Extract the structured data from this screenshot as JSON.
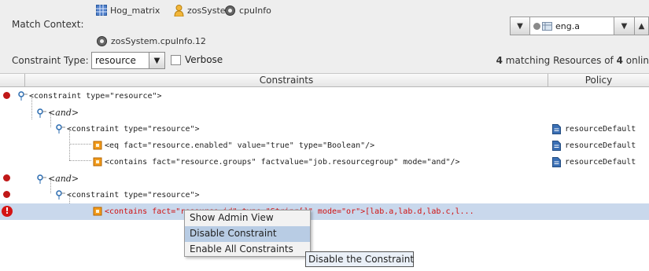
{
  "header": {
    "match_context_label": "Match Context:",
    "context_items": [
      {
        "label": "Hog_matrix",
        "icon": "grid-icon"
      },
      {
        "label": "zosSystem",
        "icon": "user-icon"
      },
      {
        "label": "cpuInfo",
        "icon": "gear-icon"
      },
      {
        "label": "zosSystem.cpuInfo.12",
        "icon": "gear-icon"
      }
    ],
    "environment_value": "eng.a"
  },
  "filter": {
    "constraint_type_label": "Constraint Type:",
    "constraint_type_value": "resource",
    "verbose_label": "Verbose",
    "match_count": "4",
    "match_text": " matching Resources of ",
    "match_total": "4",
    "match_suffix": " onlin"
  },
  "table": {
    "columns": [
      "Constraints",
      "Policy"
    ],
    "rows": [
      {
        "text": "<constraint type=\"resource\">",
        "marker": "dot"
      },
      {
        "text": "<and>",
        "marker": ""
      },
      {
        "text": "<constraint type=\"resource\">",
        "marker": "",
        "policy": "resourceDefault"
      },
      {
        "text": "<eq fact=\"resource.enabled\" value=\"true\" type=\"Boolean\"/>",
        "marker": "",
        "policy": "resourceDefault"
      },
      {
        "text": "<contains fact=\"resource.groups\" factvalue=\"job.resourcegroup\" mode=\"and\"/>",
        "marker": "",
        "policy": "resourceDefault"
      },
      {
        "text": "<and>",
        "marker": "dot"
      },
      {
        "text": "<constraint type=\"resource\">",
        "marker": "dot"
      },
      {
        "text": "<contains fact=\"resource.id\" type=\"String[]\" mode=\"or\">[lab.a,lab.d,lab.c,l...",
        "marker": "error",
        "selected": true
      }
    ]
  },
  "context_menu": {
    "items": [
      "Show Admin View",
      "Disable Constraint",
      "Enable All Constraints"
    ],
    "hovered": "Disable Constraint"
  },
  "tooltip": "Disable the Constraint",
  "colors": {
    "selection": "#c9d8ec",
    "error_red": "#d01010",
    "marker_red": "#c01818",
    "menu_hover": "#b8cce4"
  }
}
